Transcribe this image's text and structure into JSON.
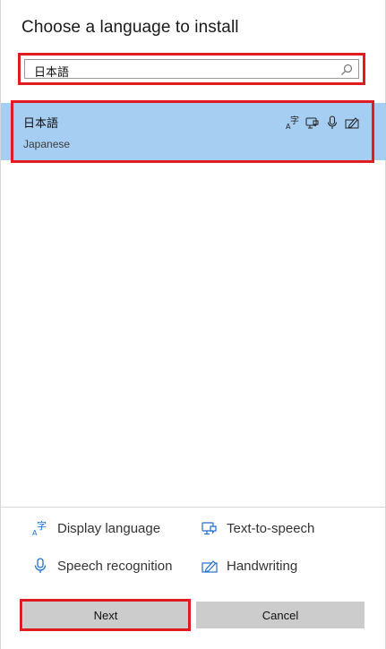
{
  "dialog": {
    "title": "Choose a language to install"
  },
  "search": {
    "value": "日本語",
    "icon": "search-icon"
  },
  "results": [
    {
      "native_name": "日本語",
      "english_name": "Japanese",
      "selected": true,
      "features": [
        "display-language-icon",
        "text-to-speech-icon",
        "speech-recognition-icon",
        "handwriting-icon"
      ]
    }
  ],
  "legend": {
    "display_language": "Display language",
    "text_to_speech": "Text-to-speech",
    "speech_recognition": "Speech recognition",
    "handwriting": "Handwriting"
  },
  "buttons": {
    "next": "Next",
    "cancel": "Cancel"
  },
  "colors": {
    "selection": "#a6cdf2",
    "highlight_outline": "#e11b22",
    "button_bg": "#cccccc",
    "icon_blue": "#1f6fd1"
  }
}
